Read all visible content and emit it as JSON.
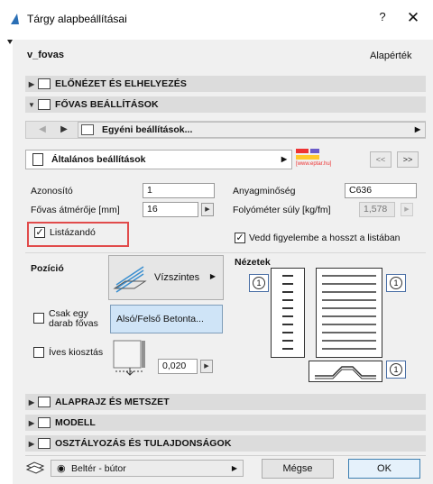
{
  "window": {
    "title": "Tárgy alapbeállításai",
    "help": "?",
    "close": "✕"
  },
  "object": {
    "name": "v_fovas",
    "default_label": "Alapérték"
  },
  "sections": {
    "preview": "ELŐNÉZET ÉS ELHELYEZÉS",
    "settings": "FŐVAS BEÁLLÍTÁSOK",
    "floorplan": "ALAPRAJZ ÉS METSZET",
    "model": "MODELL",
    "classification": "OSZTÁLYOZÁS ÉS TULAJDONSÁGOK"
  },
  "favorites": {
    "label": "Egyéni beállítások..."
  },
  "panel": {
    "label": "Általános beállítások",
    "logo_text": "[www.eptar.hu]",
    "prev": "<<",
    "next": ">>"
  },
  "fields": {
    "id_label": "Azonosító",
    "id_value": "1",
    "diameter_label": "Fővas átmérője [mm]",
    "diameter_value": "16",
    "material_label": "Anyagminőség",
    "material_value": "C636",
    "weight_label": "Folyóméter súly [kg/fm]",
    "weight_value": "1,578"
  },
  "checks": {
    "list_label": "Listázandó",
    "list_checked": true,
    "length_label": "Vedd figyelembe a hosszt a listában",
    "length_checked": true,
    "single_label": "Csak egy darab fővas",
    "single_checked": false,
    "curved_label": "Íves kiosztás",
    "curved_checked": false
  },
  "position": {
    "label": "Pozíció",
    "orientation": "Vízszintes",
    "concrete": "Alsó/Felső Betonta...",
    "cover_value": "0,020"
  },
  "views": {
    "label": "Nézetek",
    "marker": "1"
  },
  "footer": {
    "layer": "Beltér - bútor",
    "cancel": "Mégse",
    "ok": "OK"
  }
}
